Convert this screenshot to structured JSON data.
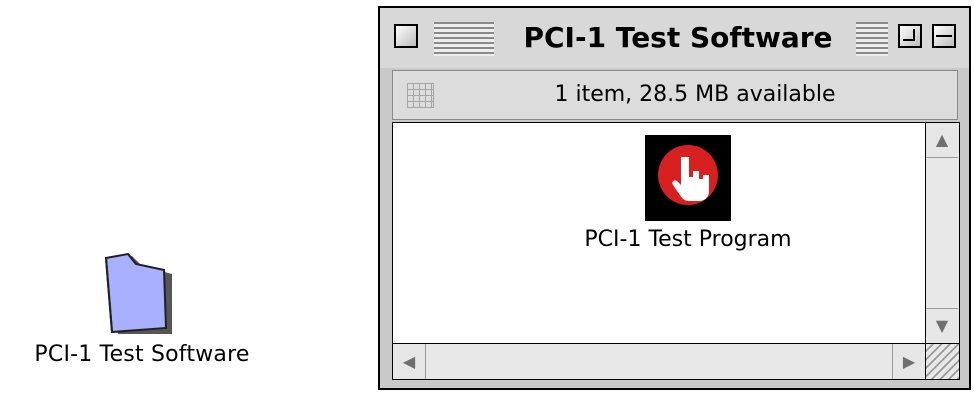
{
  "desktop": {
    "folder_label": "PCI-1 Test Software"
  },
  "window": {
    "title": "PCI-1 Test Software",
    "status": "1 item, 28.5 MB available",
    "items": [
      {
        "label": "PCI-1 Test Program",
        "icon": "red-hand-pointer-icon"
      }
    ]
  },
  "colors": {
    "folder": "#a9b0ff",
    "program_icon_bg": "#000000",
    "program_icon_circle": "#d82020"
  }
}
